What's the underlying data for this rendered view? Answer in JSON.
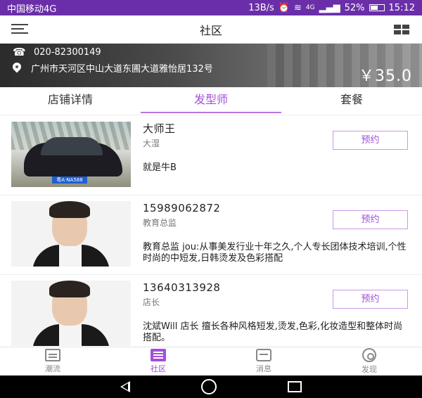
{
  "status_bar": {
    "carrier": "中国移动4G",
    "speed": "13B/s",
    "network": "4G",
    "battery": "52%",
    "battery_level": 0.52,
    "time": "15:12"
  },
  "header": {
    "title": "社区"
  },
  "store": {
    "phone": "020-82300149",
    "address": "广州市天河区中山大道东圃大道雅怡居132号",
    "price": "￥35.0"
  },
  "tabs": [
    {
      "label": "店铺详情",
      "active": false
    },
    {
      "label": "发型师",
      "active": true
    },
    {
      "label": "套餐",
      "active": false
    }
  ],
  "stylists": [
    {
      "name": "大师王",
      "role": "大湿",
      "desc": "就是牛B",
      "book_label": "预约",
      "plate": "粤A·NA588"
    },
    {
      "name": "15989062872",
      "role": "教育总监",
      "desc": "教育总监 jou:从事美发行业十年之久,个人专长团体技术培训,个性时尚的中短发,日韩烫发及色彩搭配",
      "book_label": "预约"
    },
    {
      "name": "13640313928",
      "role": "店长",
      "desc": "沈斌Will 店长 擅长各种风格短发,烫发,色彩,化妆造型和整体时尚搭配。",
      "book_label": "预约"
    }
  ],
  "bottom_nav": [
    {
      "label": "潮流",
      "icon": "trend-icon",
      "active": false
    },
    {
      "label": "社区",
      "icon": "community-icon",
      "active": true
    },
    {
      "label": "消息",
      "icon": "message-icon",
      "active": false
    },
    {
      "label": "发现",
      "icon": "discover-icon",
      "active": false
    }
  ],
  "colors": {
    "accent": "#a24fd8",
    "status_bar": "#6a2fa8"
  }
}
